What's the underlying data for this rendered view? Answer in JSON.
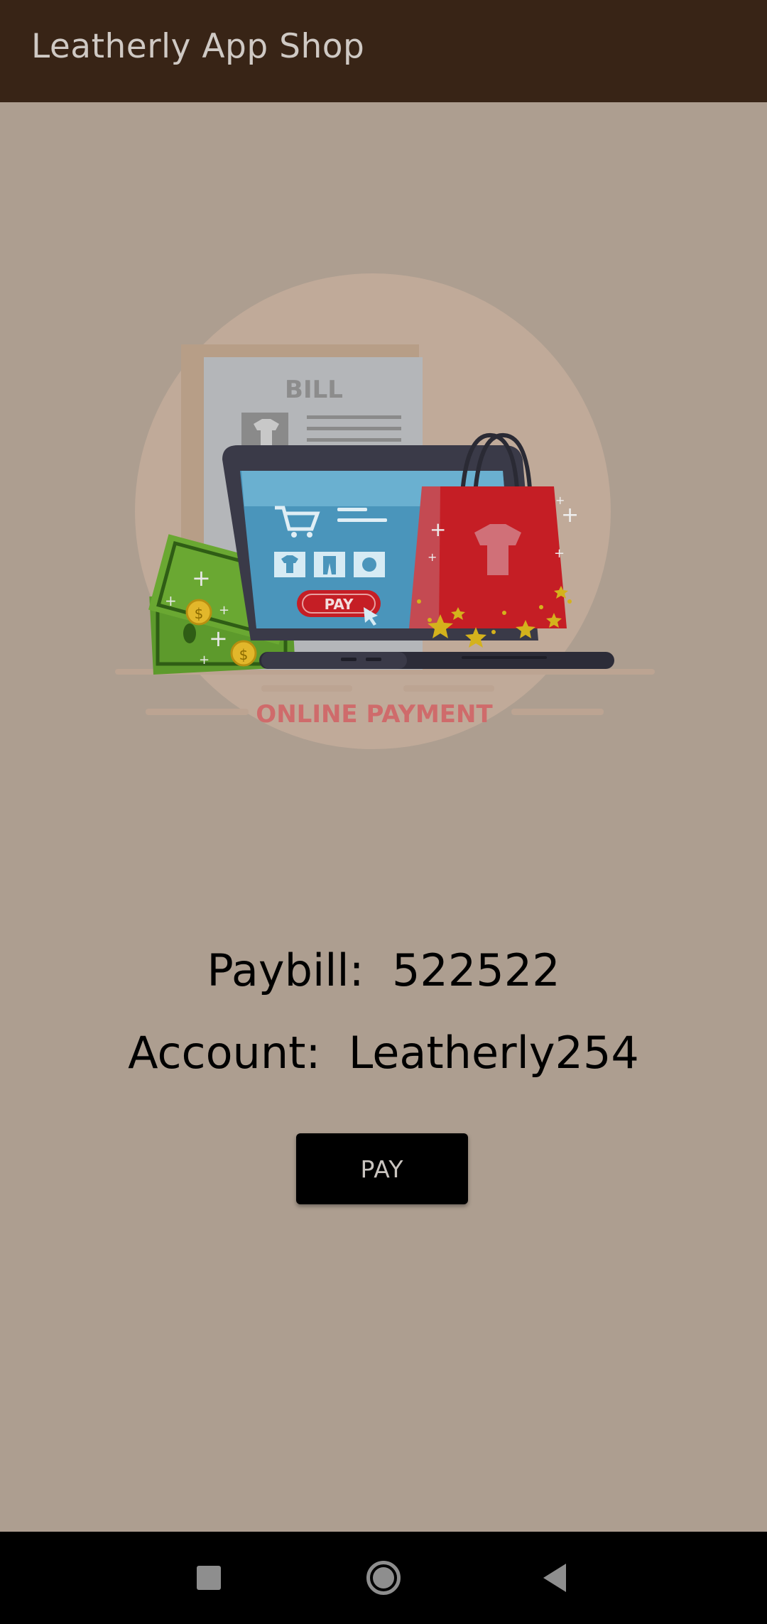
{
  "app_bar": {
    "title": "Leatherly App Shop"
  },
  "illustration": {
    "bill_label": "BILL",
    "screen_pay_label": "PAY",
    "caption": "ONLINE PAYMENT",
    "colors": {
      "circle": "#c0aa99",
      "bag": "#c51e25",
      "screen": "#4a95bb",
      "money": "#5d9a2c",
      "caption": "#cf6b6b"
    }
  },
  "payment": {
    "paybill_label": "Paybill:",
    "paybill_value": "522522",
    "account_label": "Account:",
    "account_value": "Leatherly254"
  },
  "pay_button": {
    "label": "PAY"
  },
  "nav_bar": {
    "recents": "square-icon",
    "home": "circle-icon",
    "back": "triangle-back-icon"
  },
  "colors": {
    "app_bar": "#382416",
    "background": "#ad9e90",
    "button": "#000000",
    "nav_bar": "#000000"
  }
}
